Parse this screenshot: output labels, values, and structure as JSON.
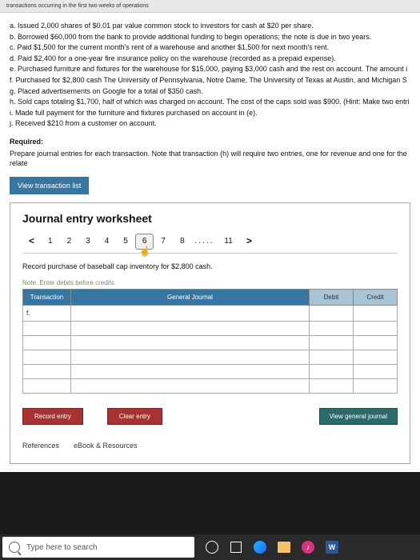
{
  "header_frag": "transactions occurring in the first two weeks of operations",
  "problem_items": [
    "a. Issued 2,000 shares of $0.01 par value common stock to investors for cash at $20 per share.",
    "b. Borrowed $60,000 from the bank to provide additional funding to begin operations; the note is due in two years.",
    "c. Paid $1,500 for the current month's rent of a warehouse and another $1,500 for next month's rent.",
    "d. Paid $2,400 for a one-year fire insurance policy on the warehouse (recorded as a prepaid expense).",
    "e. Purchased furniture and fixtures for the warehouse for $15,000, paying $3,000 cash and the rest on account. The amount i",
    "f. Purchased for $2,800 cash The University of Pennsylvania, Notre Dame, The University of Texas at Austin, and Michigan S",
    "g. Placed advertisements on Google for a total of $350 cash.",
    "h. Sold caps totaling $1,700, half of which was charged on account. The cost of the caps sold was $900. (Hint: Make two entri",
    "i. Made full payment for the furniture and fixtures purchased on account in (e).",
    "j. Received $210 from a customer on account."
  ],
  "required_label": "Required:",
  "required_text": "Prepare journal entries for each transaction. Note that transaction (h) will require two entries, one for revenue and one for the relate",
  "view_trans": "View transaction list",
  "worksheet": {
    "title": "Journal entry worksheet",
    "tabs": [
      "1",
      "2",
      "3",
      "4",
      "5",
      "6",
      "7",
      "8",
      "11"
    ],
    "active_tab": "6",
    "instruction": "Record purchase of baseball cap inventory for $2,800 cash.",
    "note": "Note: Enter debits before credits.",
    "headers": {
      "transaction": "Transaction",
      "general": "General Journal",
      "debit": "Debit",
      "credit": "Credit"
    },
    "first_cell": "f.",
    "buttons": {
      "record": "Record entry",
      "clear": "Clear entry",
      "view": "View general journal"
    }
  },
  "refs": {
    "references": "References",
    "ebook": "eBook & Resources"
  },
  "taskbar": {
    "search_placeholder": "Type here to search",
    "word": "W"
  }
}
